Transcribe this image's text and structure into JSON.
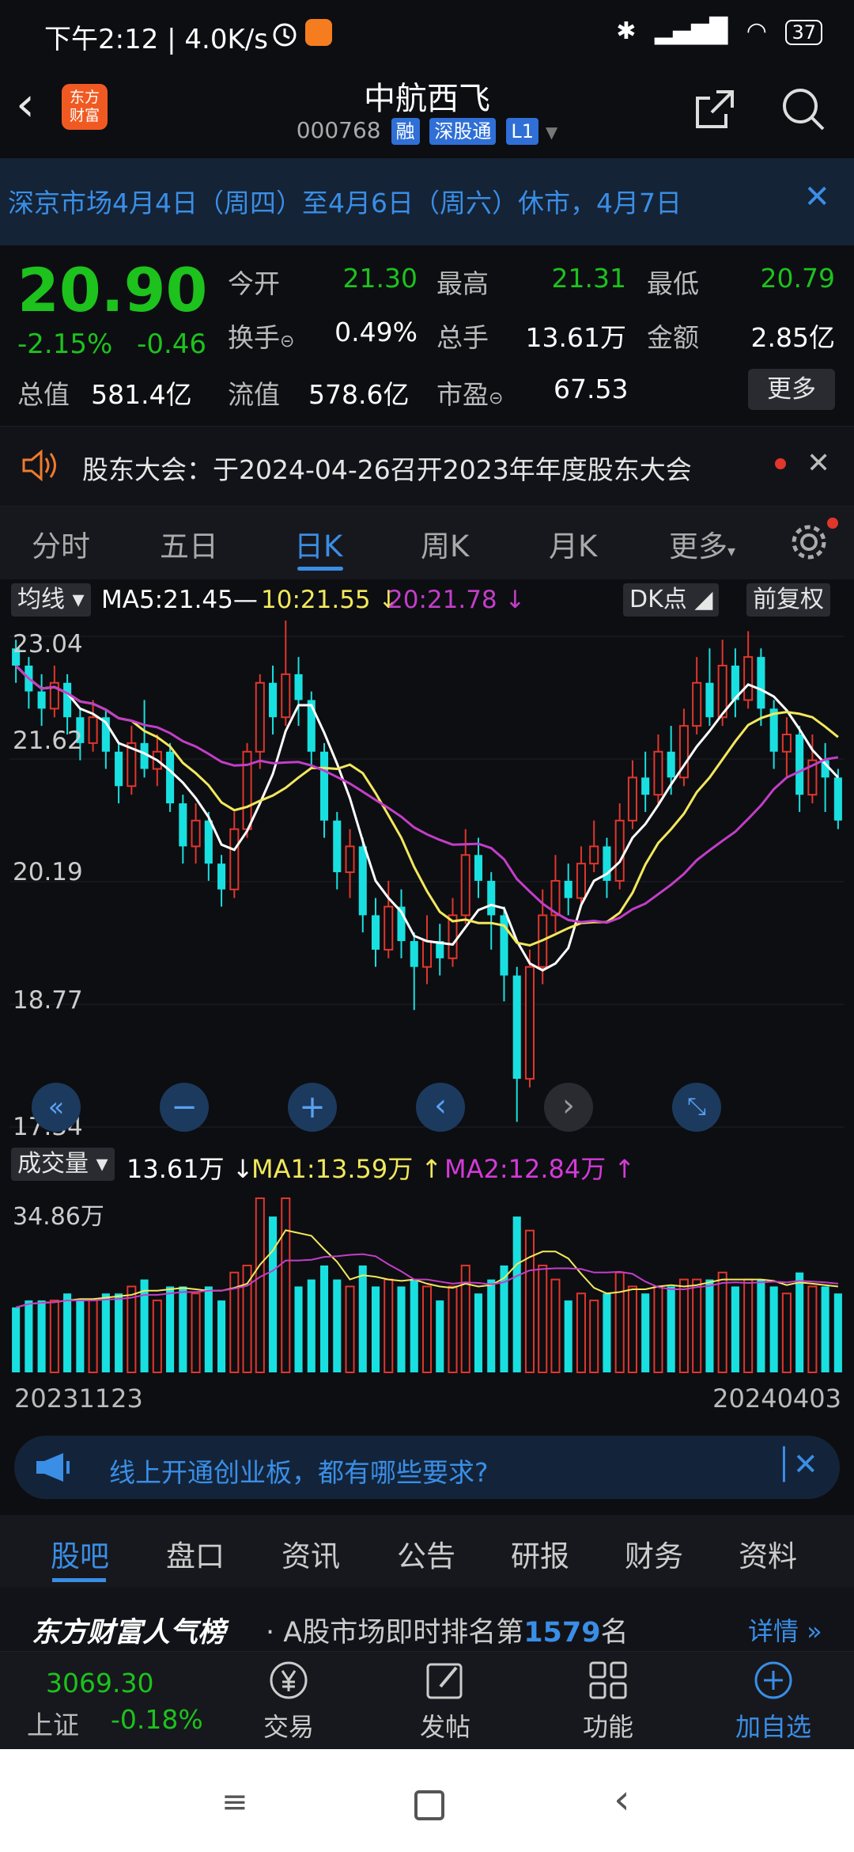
{
  "status": {
    "time": "下午2:12 | 4.0K/s",
    "battery": "37"
  },
  "header": {
    "title": "中航西飞",
    "code": "000768",
    "tags": [
      "融",
      "深股通",
      "L1"
    ],
    "logo": "东方\n财富"
  },
  "notice": {
    "text": "深京市场4月4日（周四）至4月6日（周六）休市，4月7日"
  },
  "quote": {
    "price": "20.90",
    "change_pct": "-2.15%",
    "change": "-0.46",
    "cap_label": "总值",
    "cap": "581.4亿",
    "fcap_label": "流值",
    "fcap": "578.6亿",
    "pe_label": "市盈",
    "pe": "67.53",
    "open_label": "今开",
    "open": "21.30",
    "high_label": "最高",
    "high": "21.31",
    "low_label": "最低",
    "low": "20.79",
    "turnover_label": "换手",
    "turnover": "0.49%",
    "vol_label": "总手",
    "vol": "13.61万",
    "amount_label": "金额",
    "amount": "2.85亿",
    "more": "更多"
  },
  "announce": {
    "text": "股东大会：于2024-04-26召开2023年年度股东大会"
  },
  "tabs": [
    "分时",
    "五日",
    "日K",
    "周K",
    "月K",
    "更多"
  ],
  "ma": {
    "type": "均线",
    "ma5": "MA5:21.45—",
    "ma10": "10:21.55 ↓",
    "ma20": "20:21.78 ↓",
    "dk": "DK点",
    "adj": "前复权"
  },
  "axis": {
    "y1": "23.04",
    "y2": "21.62",
    "y3": "20.19",
    "y4": "18.77",
    "y5": "17.34"
  },
  "volume": {
    "label": "成交量",
    "value": "13.61万 ↓",
    "ma1": "MA1:13.59万 ↑",
    "ma2": "MA2:12.84万 ↑",
    "max": "34.86万"
  },
  "dates": {
    "start": "20231123",
    "end": "20240403"
  },
  "ad": {
    "text": "线上开通创业板，都有哪些要求?"
  },
  "bottom_tabs": [
    "股吧",
    "盘口",
    "资讯",
    "公告",
    "研报",
    "财务",
    "资料"
  ],
  "rank": {
    "brand": "东方财富人气榜",
    "prefix": "· A股市场即时排名第",
    "num": "1579",
    "suffix": "名",
    "detail": "详情 »"
  },
  "dock": {
    "index_val": "3069.30",
    "index_name": "上证",
    "index_chg": "-0.18%",
    "items": [
      "交易",
      "发帖",
      "功能",
      "加自选"
    ]
  },
  "colors": {
    "up": "#e0362c",
    "down": "#1dc21d",
    "accent": "#3a8ee6",
    "ma5": "#ffffff",
    "ma10": "#f2e85c",
    "ma20": "#c23ec8",
    "candle_down": "#19e0e0"
  },
  "chart_data": {
    "type": "candlestick",
    "title": "",
    "ylim": [
      17.34,
      23.04
    ],
    "candles": [
      [
        22.9,
        22.7,
        23.0,
        22.5
      ],
      [
        22.7,
        22.4,
        22.8,
        22.2
      ],
      [
        22.4,
        22.2,
        22.6,
        22.0
      ],
      [
        22.2,
        22.5,
        22.7,
        22.1
      ],
      [
        22.5,
        22.1,
        22.6,
        21.9
      ],
      [
        22.1,
        21.8,
        22.2,
        21.6
      ],
      [
        21.8,
        22.1,
        22.3,
        21.7
      ],
      [
        22.1,
        21.7,
        22.2,
        21.5
      ],
      [
        21.7,
        21.3,
        21.8,
        21.1
      ],
      [
        21.3,
        21.8,
        22.0,
        21.2
      ],
      [
        21.8,
        21.5,
        22.3,
        21.4
      ],
      [
        21.5,
        21.7,
        21.9,
        21.3
      ],
      [
        21.7,
        21.1,
        21.8,
        21.0
      ],
      [
        21.1,
        20.6,
        21.2,
        20.4
      ],
      [
        20.6,
        20.9,
        21.1,
        20.4
      ],
      [
        20.9,
        20.4,
        21.0,
        20.2
      ],
      [
        20.4,
        20.1,
        20.5,
        19.9
      ],
      [
        20.1,
        20.8,
        21.0,
        20.0
      ],
      [
        20.8,
        21.7,
        21.8,
        20.7
      ],
      [
        21.7,
        22.5,
        22.6,
        21.5
      ],
      [
        22.5,
        22.1,
        22.7,
        21.9
      ],
      [
        22.1,
        22.6,
        23.3,
        22.0
      ],
      [
        22.6,
        22.3,
        22.8,
        22.0
      ],
      [
        22.3,
        21.7,
        22.4,
        21.5
      ],
      [
        21.7,
        20.9,
        21.8,
        20.7
      ],
      [
        20.9,
        20.3,
        21.0,
        20.1
      ],
      [
        20.3,
        20.6,
        20.8,
        20.0
      ],
      [
        20.6,
        19.8,
        20.7,
        19.6
      ],
      [
        19.8,
        19.4,
        20.0,
        19.2
      ],
      [
        19.4,
        19.9,
        20.2,
        19.3
      ],
      [
        19.9,
        19.5,
        20.1,
        19.3
      ],
      [
        19.5,
        19.2,
        19.6,
        18.7
      ],
      [
        19.2,
        19.5,
        19.8,
        19.0
      ],
      [
        19.5,
        19.3,
        19.7,
        19.1
      ],
      [
        19.3,
        19.8,
        20.0,
        19.2
      ],
      [
        19.8,
        20.5,
        20.8,
        19.7
      ],
      [
        20.5,
        20.2,
        20.7,
        20.0
      ],
      [
        20.2,
        19.8,
        20.3,
        19.4
      ],
      [
        19.8,
        19.1,
        19.9,
        18.8
      ],
      [
        19.1,
        17.9,
        19.2,
        17.4
      ],
      [
        17.9,
        19.2,
        19.4,
        17.8
      ],
      [
        19.2,
        19.8,
        20.1,
        19.0
      ],
      [
        19.8,
        20.2,
        20.5,
        19.6
      ],
      [
        20.2,
        20.0,
        20.4,
        19.8
      ],
      [
        20.0,
        20.4,
        20.6,
        19.9
      ],
      [
        20.4,
        20.6,
        20.9,
        20.3
      ],
      [
        20.6,
        20.2,
        20.7,
        20.0
      ],
      [
        20.2,
        20.9,
        21.1,
        20.1
      ],
      [
        20.9,
        21.4,
        21.6,
        20.8
      ],
      [
        21.4,
        21.2,
        21.7,
        21.0
      ],
      [
        21.2,
        21.7,
        21.9,
        21.1
      ],
      [
        21.7,
        21.4,
        22.0,
        21.2
      ],
      [
        21.4,
        22.0,
        22.2,
        21.3
      ],
      [
        22.0,
        22.5,
        22.8,
        21.9
      ],
      [
        22.5,
        22.1,
        22.9,
        22.0
      ],
      [
        22.1,
        22.7,
        23.0,
        22.0
      ],
      [
        22.7,
        22.3,
        22.9,
        22.1
      ],
      [
        22.3,
        22.8,
        23.1,
        22.2
      ],
      [
        22.8,
        22.2,
        22.9,
        22.0
      ],
      [
        22.2,
        21.7,
        22.3,
        21.5
      ],
      [
        21.7,
        21.9,
        22.1,
        21.4
      ],
      [
        21.9,
        21.2,
        22.0,
        21.0
      ],
      [
        21.2,
        21.6,
        21.9,
        21.1
      ],
      [
        21.6,
        21.4,
        21.8,
        21.0
      ],
      [
        21.4,
        20.9,
        21.5,
        20.8
      ]
    ],
    "volume_max": 34.86
  }
}
